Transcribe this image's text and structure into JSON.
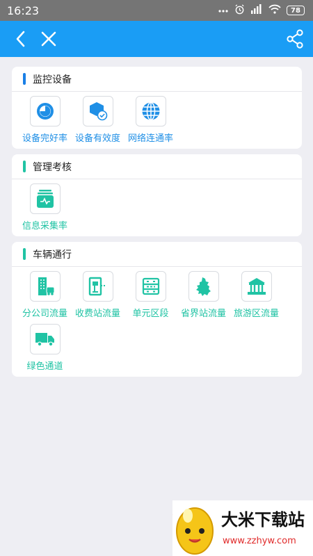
{
  "status_bar": {
    "time": "16:23",
    "battery": "78"
  },
  "colors": {
    "app_bar": "#1a9df5",
    "blue": "#1f8fe6",
    "teal": "#20c3a4"
  },
  "app_bar": {
    "icons": [
      "back-icon",
      "close-icon",
      "share-icon"
    ]
  },
  "sections": [
    {
      "title": "监控设备",
      "bar_color": "#1a7fe6",
      "items": [
        {
          "label": "设备完好率",
          "icon": "pie-chart-icon"
        },
        {
          "label": "设备有效度",
          "icon": "shield-check-icon"
        },
        {
          "label": "网络连通率",
          "icon": "globe-icon"
        }
      ]
    },
    {
      "title": "管理考核",
      "bar_color": "#20c3a4",
      "items": [
        {
          "label": "信息采集率",
          "icon": "data-collection-icon"
        }
      ]
    },
    {
      "title": "车辆通行",
      "bar_color": "#20c3a4",
      "items": [
        {
          "label": "分公司流量",
          "icon": "building-icon"
        },
        {
          "label": "收费站流量",
          "icon": "toll-station-icon"
        },
        {
          "label": "单元区段",
          "icon": "road-segment-icon"
        },
        {
          "label": "省界站流量",
          "icon": "province-map-icon"
        },
        {
          "label": "旅游区流量",
          "icon": "temple-icon"
        },
        {
          "label": "绿色通道",
          "icon": "truck-icon"
        }
      ]
    }
  ],
  "watermark": {
    "logo_text": "大米下载站",
    "url": "www.zzhyw.com"
  }
}
